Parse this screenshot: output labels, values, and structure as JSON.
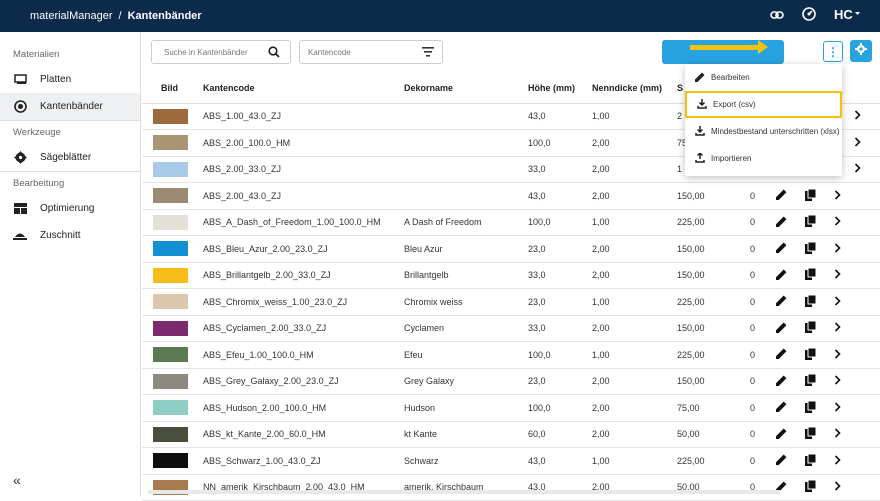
{
  "topbar": {
    "app": "materialManager",
    "sep": "/",
    "page": "Kantenbänder"
  },
  "sidebar": {
    "sections": [
      {
        "title": "Materialien",
        "items": [
          {
            "label": "Platten",
            "icon": "panel-icon"
          },
          {
            "label": "Kantenbänder",
            "icon": "edgeband-icon"
          }
        ]
      },
      {
        "title": "Werkzeuge",
        "items": [
          {
            "label": "Sägeblätter",
            "icon": "sawblade-icon"
          }
        ]
      },
      {
        "title": "Bearbeitung",
        "items": [
          {
            "label": "Optimierung",
            "icon": "optimize-icon"
          },
          {
            "label": "Zuschnitt",
            "icon": "cut-icon"
          }
        ]
      }
    ],
    "collapse": "«"
  },
  "toolbar": {
    "search_placeholder": "Suche in Kantenbänder",
    "code_placeholder": "Kantencode",
    "more": "⋮"
  },
  "table": {
    "headers": [
      "Bild",
      "Kantencode",
      "Dekorname",
      "Höhe (mm)",
      "Nenndicke (mm)",
      "S"
    ],
    "rows": [
      {
        "color": "#9c6a3c",
        "code": "ABS_1.00_43.0_ZJ",
        "dekor": "",
        "hoehe": "43,0",
        "dicke": "1,00",
        "s": "2",
        "qty": ""
      },
      {
        "color": "#a99474",
        "code": "ABS_2.00_100.0_HM",
        "dekor": "",
        "hoehe": "100,0",
        "dicke": "2,00",
        "s": "75",
        "qty": ""
      },
      {
        "color": "#a8c9e8",
        "code": "ABS_2.00_33.0_ZJ",
        "dekor": "",
        "hoehe": "33,0",
        "dicke": "2,00",
        "s": "1",
        "qty": ""
      },
      {
        "color": "#9c8a72",
        "code": "ABS_2.00_43.0_ZJ",
        "dekor": "",
        "hoehe": "43,0",
        "dicke": "2,00",
        "s": "150,00",
        "qty": "0"
      },
      {
        "color": "#e3e0d8",
        "code": "ABS_A_Dash_of_Freedom_1.00_100.0_HM",
        "dekor": "A Dash of Freedom",
        "hoehe": "100,0",
        "dicke": "1,00",
        "s": "225,00",
        "qty": "0"
      },
      {
        "color": "#1390d4",
        "code": "ABS_Bleu_Azur_2.00_23.0_ZJ",
        "dekor": "Bleu Azur",
        "hoehe": "23,0",
        "dicke": "2,00",
        "s": "150,00",
        "qty": "0"
      },
      {
        "color": "#f6bd19",
        "code": "ABS_Brillantgelb_2.00_33.0_ZJ",
        "dekor": "Brillantgelb",
        "hoehe": "33,0",
        "dicke": "2,00",
        "s": "150,00",
        "qty": "0"
      },
      {
        "color": "#dcc6ae",
        "code": "ABS_Chromix_weiss_1.00_23.0_ZJ",
        "dekor": "Chromix weiss",
        "hoehe": "23,0",
        "dicke": "1,00",
        "s": "225,00",
        "qty": "0"
      },
      {
        "color": "#7c2a6e",
        "code": "ABS_Cyclamen_2.00_33.0_ZJ",
        "dekor": "Cyclamen",
        "hoehe": "33,0",
        "dicke": "2,00",
        "s": "150,00",
        "qty": "0"
      },
      {
        "color": "#5c7a52",
        "code": "ABS_Efeu_1.00_100.0_HM",
        "dekor": "Efeu",
        "hoehe": "100,0",
        "dicke": "1,00",
        "s": "225,00",
        "qty": "0"
      },
      {
        "color": "#8c8a80",
        "code": "ABS_Grey_Galaxy_2.00_23.0_ZJ",
        "dekor": "Grey Galaxy",
        "hoehe": "23,0",
        "dicke": "2,00",
        "s": "150,00",
        "qty": "0"
      },
      {
        "color": "#8ecdc4",
        "code": "ABS_Hudson_2.00_100.0_HM",
        "dekor": "Hudson",
        "hoehe": "100,0",
        "dicke": "2,00",
        "s": "75,00",
        "qty": "0"
      },
      {
        "color": "#4a4e3e",
        "code": "ABS_kt_Kante_2.00_60.0_HM",
        "dekor": "kt Kante",
        "hoehe": "60,0",
        "dicke": "2,00",
        "s": "50,00",
        "qty": "0"
      },
      {
        "color": "#0e0e0e",
        "code": "ABS_Schwarz_1.00_43.0_ZJ",
        "dekor": "Schwarz",
        "hoehe": "43,0",
        "dicke": "1,00",
        "s": "225,00",
        "qty": "0"
      },
      {
        "color": "#a87a50",
        "code": "NN_amerik_Kirschbaum_2.00_43.0_HM",
        "dekor": "amerik. Kirschbaum",
        "hoehe": "43,0",
        "dicke": "2,00",
        "s": "50,00",
        "qty": "0"
      }
    ]
  },
  "menu": {
    "items": [
      {
        "label": "Bearbeiten",
        "icon": "pencil-icon"
      },
      {
        "label": "Export (csv)",
        "icon": "download-icon"
      },
      {
        "label": "Mindestbestand unterschritten (xlsx)",
        "icon": "download-icon"
      },
      {
        "label": "Importieren",
        "icon": "upload-icon"
      }
    ]
  },
  "colors": {
    "topbar": "#0c2b4a",
    "accent": "#29a3e0",
    "highlight": "#f3c20f"
  }
}
